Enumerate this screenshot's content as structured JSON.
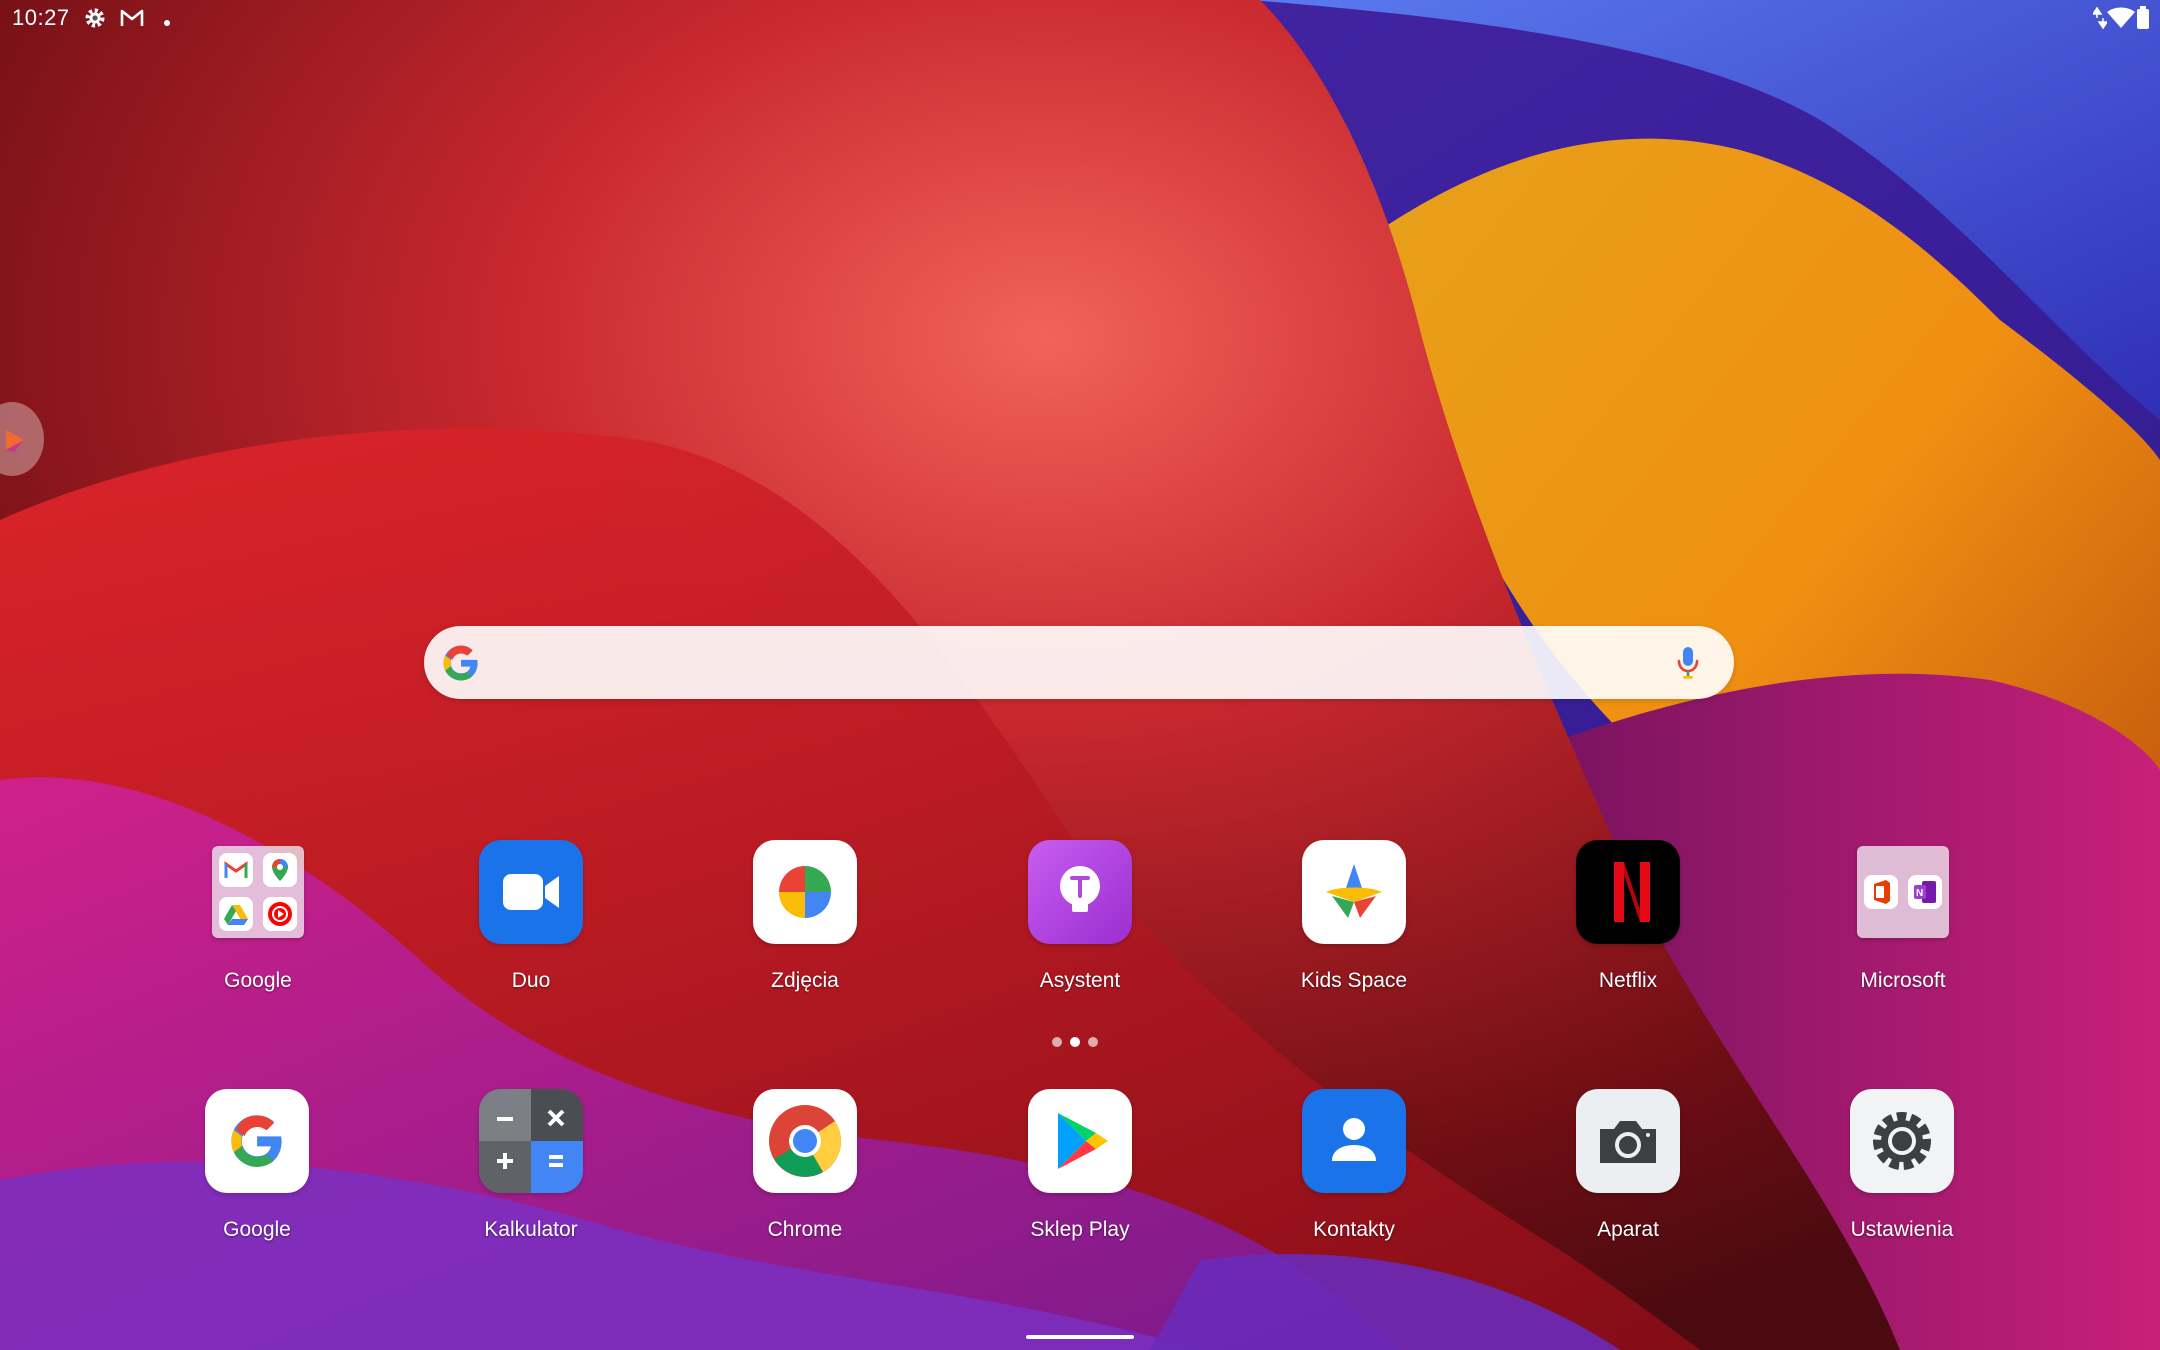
{
  "status_bar": {
    "time": "10:27",
    "icons_left": [
      "settings-icon",
      "gmail-icon",
      "notification-dot-icon"
    ],
    "icons_right": [
      "data-arrows-icon",
      "wifi-icon",
      "battery-icon"
    ]
  },
  "search": {
    "logo": "google-g-icon",
    "mic": "mic-icon"
  },
  "apps": [
    {
      "label": "Google",
      "kind": "folder",
      "contents": [
        "gmail-icon",
        "maps-icon",
        "drive-icon",
        "youtube-music-icon"
      ]
    },
    {
      "label": "Duo",
      "icon": "video-camera-icon",
      "color": "#1a73e8"
    },
    {
      "label": "Zdjęcia",
      "icon": "pinwheel-icon"
    },
    {
      "label": "Asystent",
      "icon": "lightbulb-icon",
      "color": "#b14bd8"
    },
    {
      "label": "Kids Space",
      "icon": "kids-space-icon"
    },
    {
      "label": "Netflix",
      "icon": "netflix-n-icon",
      "color": "#000000"
    },
    {
      "label": "Microsoft",
      "kind": "folder",
      "contents": [
        "office-icon",
        "onenote-icon"
      ]
    }
  ],
  "dock": [
    {
      "label": "Google",
      "icon": "google-g-icon"
    },
    {
      "label": "Kalkulator",
      "icon": "calculator-icon"
    },
    {
      "label": "Chrome",
      "icon": "chrome-icon"
    },
    {
      "label": "Sklep Play",
      "icon": "play-store-icon"
    },
    {
      "label": "Kontakty",
      "icon": "person-icon",
      "color": "#1a73e8"
    },
    {
      "label": "Aparat",
      "icon": "camera-icon"
    },
    {
      "label": "Ustawienia",
      "icon": "settings-gear-icon"
    }
  ],
  "page_indicator": {
    "pages": 3,
    "current": 2
  }
}
